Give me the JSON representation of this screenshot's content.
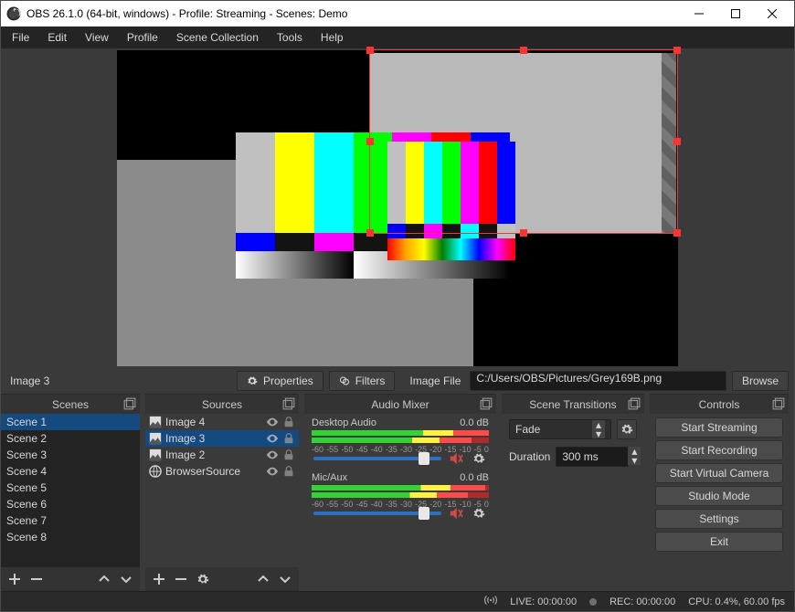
{
  "window": {
    "title": "OBS 26.1.0 (64-bit, windows) - Profile: Streaming - Scenes: Demo"
  },
  "menu": {
    "items": [
      "File",
      "Edit",
      "View",
      "Profile",
      "Scene Collection",
      "Tools",
      "Help"
    ]
  },
  "selected_source": "Image 3",
  "buttons": {
    "properties": "Properties",
    "filters": "Filters",
    "browse": "Browse"
  },
  "image_file": {
    "label": "Image File",
    "value": "C:/Users/OBS/Pictures/Grey169B.png"
  },
  "docks": {
    "scenes": {
      "title": "Scenes",
      "items": [
        "Scene 1",
        "Scene 2",
        "Scene 3",
        "Scene 4",
        "Scene 5",
        "Scene 6",
        "Scene 7",
        "Scene 8"
      ],
      "selected": 0
    },
    "sources": {
      "title": "Sources",
      "items": [
        {
          "icon": "image",
          "name": "Image 4",
          "visible": true,
          "locked": false
        },
        {
          "icon": "image",
          "name": "Image 3",
          "visible": true,
          "locked": false
        },
        {
          "icon": "image",
          "name": "Image 2",
          "visible": true,
          "locked": false
        },
        {
          "icon": "globe",
          "name": "BrowserSource",
          "visible": true,
          "locked": false
        }
      ],
      "selected": 1
    },
    "mixer": {
      "title": "Audio Mixer",
      "ticks": [
        "-60",
        "-55",
        "-50",
        "-45",
        "-40",
        "-35",
        "-30",
        "-25",
        "-20",
        "-15",
        "-10",
        "-5",
        "0"
      ],
      "channels": [
        {
          "name": "Desktop Audio",
          "db": "0.0 dB",
          "slider": 82,
          "level1": 100,
          "level2": 90
        },
        {
          "name": "Mic/Aux",
          "db": "0.0 dB",
          "slider": 82,
          "level1": 98,
          "level2": 88
        }
      ]
    },
    "transitions": {
      "title": "Scene Transitions",
      "fade": "Fade",
      "duration_label": "Duration",
      "duration_value": "300 ms"
    },
    "controls": {
      "title": "Controls",
      "buttons": [
        "Start Streaming",
        "Start Recording",
        "Start Virtual Camera",
        "Studio Mode",
        "Settings",
        "Exit"
      ]
    }
  },
  "status": {
    "live": "LIVE: 00:00:00",
    "rec": "REC: 00:00:00",
    "cpu": "CPU: 0.4%, 60.00 fps"
  }
}
